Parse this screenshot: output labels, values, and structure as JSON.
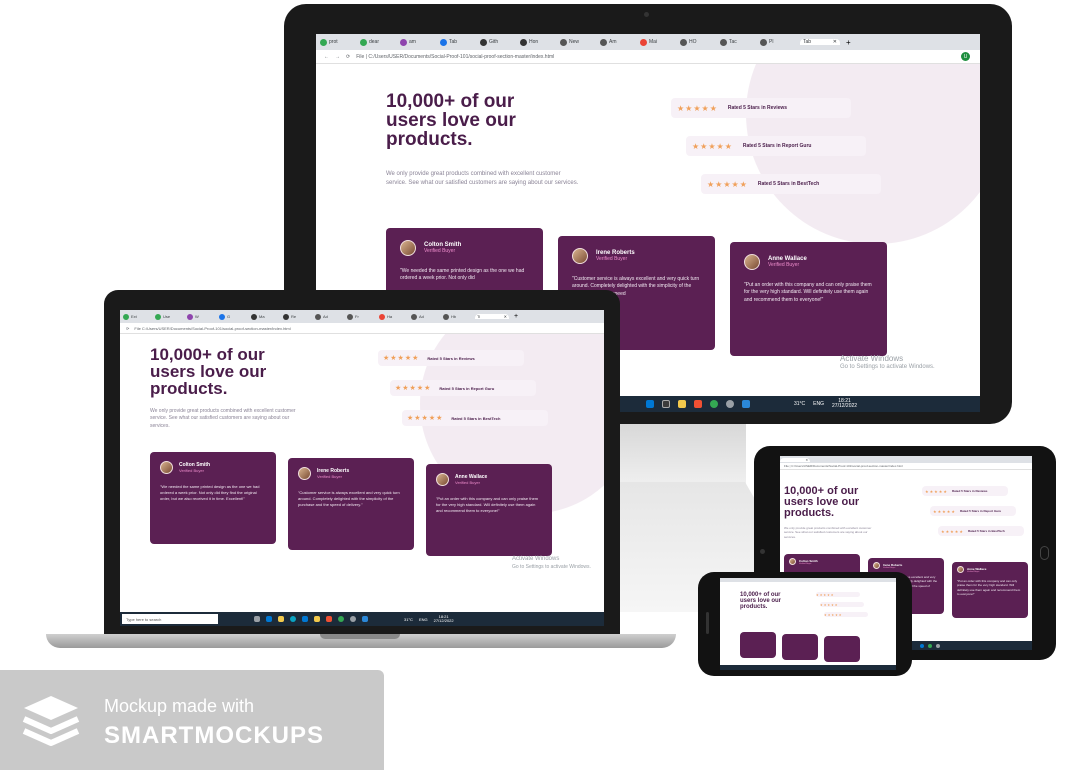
{
  "browser": {
    "tabs_monitor": [
      "prot",
      "dear",
      "am",
      "Tab",
      "Gith",
      "Hon",
      "New",
      "Am",
      "Mai",
      "HO",
      "Tac",
      "Pl",
      "Tab"
    ],
    "tabs_laptop": [
      "Ext",
      "Use",
      "W",
      "G",
      "Ma",
      "Re",
      "Ad",
      "Fr",
      "Ha",
      "Ad",
      "Hb",
      "Ti"
    ],
    "address_monitor": "File | C:/Users/USER/Documents/Social-Proof-101/social-proof-section-master/index.html",
    "address_laptop": "File  C:/Users/USER/Documents/Social-Proof-101/social-proof-section-master/index.html",
    "address_tablet": "File | C:/Users/USER/Documents/Social-Proof-101/social-proof-section-master/index.html",
    "close_glyph": "✕",
    "new_tab_glyph": "+",
    "profile_letter": "U"
  },
  "page": {
    "headline_lines": [
      "10,000+ of our",
      "users love our",
      "products."
    ],
    "description": "We only provide great products combined with excellent customer service. See what our satisfied customers are saying about our services.",
    "ratings": [
      {
        "stars": "★★★★★",
        "label": "Rated 5 Stars in Reviews"
      },
      {
        "stars": "★★★★★",
        "label": "Rated 5 Stars in Report Guru"
      },
      {
        "stars": "★★★★★",
        "label": "Rated 5 Stars in BestTech"
      }
    ],
    "testimonials": [
      {
        "name": "Colton Smith",
        "badge": "Verified Buyer",
        "quote": "\"We needed the same printed design as the one we had ordered a week prior. Not only did they find the original order, but we also received it in time. Excellent!\""
      },
      {
        "name": "Irene Roberts",
        "badge": "Verified Buyer",
        "quote": "\"Customer service is always excellent and very quick turn around. Completely delighted with the simplicity of the purchase and the speed of delivery.\""
      },
      {
        "name": "Anne Wallace",
        "badge": "Verified Buyer",
        "quote": "\"Put an order with this company and can only praise them for the very high standard. Will definitely use them again and recommend them to everyone!\""
      }
    ],
    "monitor_quote_partials": [
      "\"We needed the same printed design as the one we had ordered a week prior. Not only did",
      "\"Customer service is always excellent and very quick turn around. Completely delighted with the simplicity of the purchase and the speed",
      "\"Put an order with this company and can only praise them for the very high standard. Will definitely use them again and recommend them to everyone!\""
    ]
  },
  "windows": {
    "activate_title": "Activate Windows",
    "activate_sub": "Go to Settings to activate Windows.",
    "search_placeholder": "Type here to search",
    "weather": "31°C",
    "lang": "ENG",
    "time": "18:21",
    "date": "27/12/2022"
  },
  "badge": {
    "line1": "Mockup made with",
    "line2": "SMARTMOCKUPS"
  },
  "colors": {
    "purple_dark": "#4a1d4a",
    "card_purple": "#5b2053",
    "star_orange": "#f0a05a",
    "verified_pink": "#ee8ccc",
    "badge_gray": "#c9c9c9"
  }
}
